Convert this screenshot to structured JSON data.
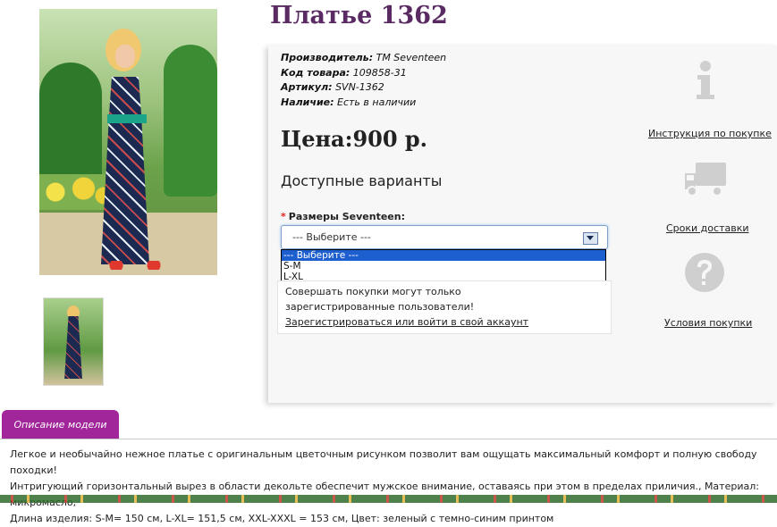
{
  "product": {
    "title": "Платье 1362",
    "manufacturer_label": "Производитель:",
    "manufacturer_value": "ТМ Seventeen",
    "code_label": "Код товара:",
    "code_value": "109858-31",
    "sku_label": "Артикул:",
    "sku_value": "SVN-1362",
    "availability_label": "Наличие:",
    "availability_value": "Есть в наличии",
    "price": "Цена:900 р."
  },
  "options": {
    "heading": "Доступные варианты",
    "required_mark": "*",
    "size_label": "Размеры Seventeen:",
    "selected": "--- Выберите ---",
    "dropdown_items": [
      "--- Выберите ---",
      "S-M",
      "L-XL"
    ]
  },
  "notice": {
    "text": "Совершать покупки могут только зарегистрированные пользователи!",
    "link": "Зарегистрироваться или войти в свой аккаунт"
  },
  "side": {
    "instruction_icon": "info-icon",
    "instruction_link": "Инструкция по покупке",
    "delivery_icon": "truck-icon",
    "delivery_link": "Сроки доставки",
    "terms_icon": "question-icon",
    "terms_link": "Условия покупки"
  },
  "description": {
    "tab_label": "Описание модели",
    "line1": "Легкое и необычайно нежное платье с оригинальным цветочным рисунком позволит вам ощущать максимальный комфорт и полную свободу походки!",
    "line2": "Интригующий горизонтальный вырез в области декольте обеспечит мужское внимание, оставаясь при этом в пределах приличия., Материал: микромасло,",
    "line3": "Длина изделия: S-M= 150 см, L-XL= 151,5 см, XXL-XXXL = 153 см, Цвет: зеленый с темно-синим принтом"
  },
  "colors": {
    "title": "#5a2a63",
    "tab": "#a0269a",
    "dropdown_selected": "#1e5fd0"
  }
}
